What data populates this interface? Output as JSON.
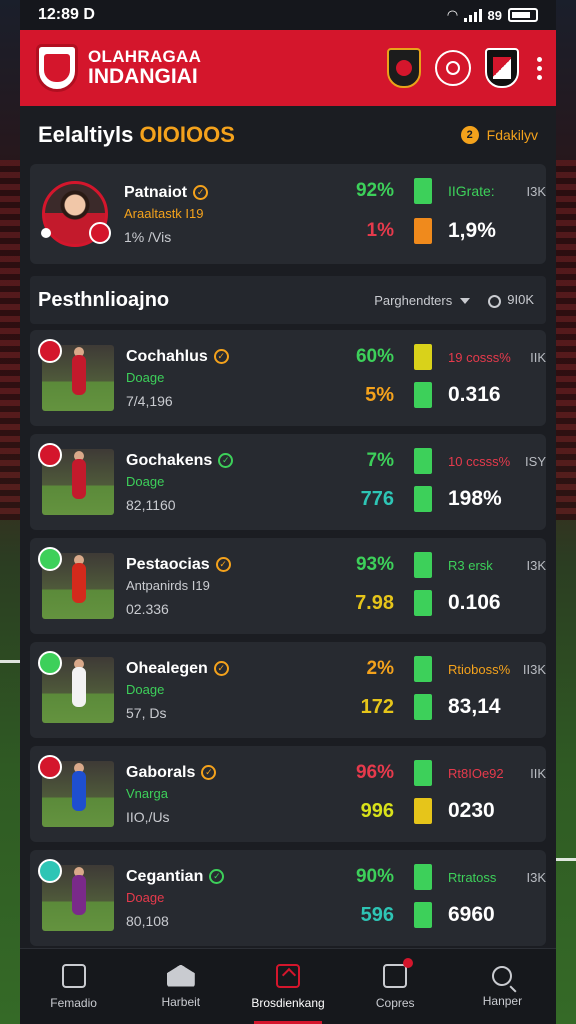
{
  "status_bar": {
    "time": "12:89",
    "indicator": "D",
    "battery_text": "89"
  },
  "header": {
    "brand_line1": "OLAHRAGAA",
    "brand_line2": "INDANGIAI"
  },
  "section": {
    "title_main": "Eelaltiyls",
    "title_accent": "OIOIOOS",
    "filter_label": "Fdakilyv",
    "filter_badge": "2"
  },
  "featured": {
    "name": "Patnaiot",
    "subtitle": "Araaltastk I19",
    "meta": "1% /Vis",
    "stat1": "92%",
    "stat1_tag": "IIGrate:",
    "stat1_unit": "I3K",
    "stat2": "1%",
    "stat2_big": "1,9%"
  },
  "list": {
    "title": "Pesthnlioajno",
    "sort_label": "Parghendters",
    "time_label": "9I0K"
  },
  "players": [
    {
      "name": "Cochahlus",
      "sub": "Doage",
      "meta": "7/4,196",
      "stat1": "60%",
      "tag1": "19 cosss%",
      "unit": "IIK",
      "stat2": "5%",
      "big": "0.316"
    },
    {
      "name": "Gochakens",
      "sub": "Doage",
      "meta": "82,1160",
      "stat1": "7%",
      "tag1": "10 ccsss%",
      "unit": "ISY",
      "stat2": "776",
      "big": "198%"
    },
    {
      "name": "Pestaocias",
      "sub": "Antpanirds I19",
      "meta": "02.336",
      "stat1": "93%",
      "tag1": "R3 ersk",
      "unit": "I3K",
      "stat2": "7.98",
      "big": "0.106"
    },
    {
      "name": "Ohealegen",
      "sub": "Doage",
      "meta": "57, Ds",
      "stat1": "2%",
      "tag1": "Rtioboss%",
      "unit": "II3K",
      "stat2": "172",
      "big": "83,14"
    },
    {
      "name": "Gaborals",
      "sub": "Vnarga",
      "meta": "IIO,/Us",
      "stat1": "96%",
      "tag1": "Rt8IOe92",
      "unit": "IIK",
      "stat2": "996",
      "big": "0230"
    },
    {
      "name": "Cegantian",
      "sub": "Doage",
      "meta": "80,108",
      "stat1": "90%",
      "tag1": "Rtratoss",
      "unit": "I3K",
      "stat2": "596",
      "big": "6960"
    }
  ],
  "nav": [
    {
      "label": "Femadio",
      "icon": "box-icon"
    },
    {
      "label": "Harbeit",
      "icon": "house-icon"
    },
    {
      "label": "Brosdienkang",
      "icon": "flag-icon"
    },
    {
      "label": "Copres",
      "icon": "cards-icon"
    },
    {
      "label": "Hanper",
      "icon": "search-icon"
    }
  ],
  "colors": {
    "brand_red": "#d4162c",
    "accent_orange": "#f4a21c",
    "green": "#3dd05a",
    "red_stat": "#e63a4c",
    "yellow": "#e6c51a",
    "teal": "#2ec5b5"
  }
}
